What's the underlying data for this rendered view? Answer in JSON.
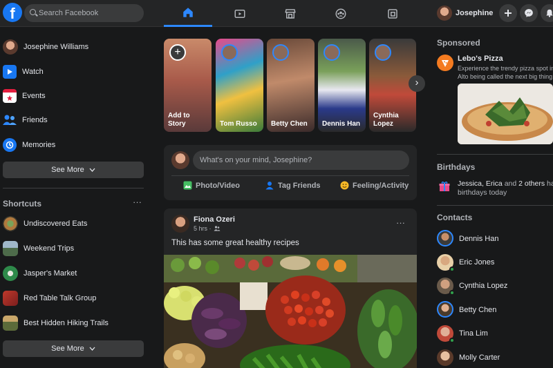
{
  "topbar": {
    "logo_letter": "f",
    "search_placeholder": "Search Facebook",
    "nav_icons": [
      "home-icon",
      "watch-icon",
      "marketplace-icon",
      "groups-icon",
      "gaming-icon"
    ],
    "profile_name": "Josephine",
    "action_icons": [
      "plus-icon",
      "messenger-icon",
      "notifications-icon"
    ],
    "accent_color": "#2d88ff"
  },
  "left_nav": {
    "items": [
      {
        "label": "Josephine Williams",
        "icon": "profile-avatar"
      },
      {
        "label": "Watch",
        "icon": "watch-icon"
      },
      {
        "label": "Events",
        "icon": "events-icon"
      },
      {
        "label": "Friends",
        "icon": "friends-icon"
      },
      {
        "label": "Memories",
        "icon": "memories-icon"
      }
    ],
    "see_more_label": "See More",
    "shortcuts_title": "Shortcuts",
    "shortcuts_menu": "···",
    "shortcuts": [
      {
        "label": "Undiscovered Eats"
      },
      {
        "label": "Weekend Trips"
      },
      {
        "label": "Jasper's Market"
      },
      {
        "label": "Red Table Talk Group"
      },
      {
        "label": "Best Hidden Hiking Trails"
      }
    ],
    "shortcuts_see_more_label": "See More"
  },
  "stories": {
    "items": [
      {
        "name_line1": "Add to",
        "name_line2": "Story"
      },
      {
        "name_line1": "Tom Russo",
        "name_line2": ""
      },
      {
        "name_line1": "Betty Chen",
        "name_line2": ""
      },
      {
        "name_line1": "Dennis Han",
        "name_line2": ""
      },
      {
        "name_line1": "Cynthia",
        "name_line2": "Lopez"
      }
    ],
    "add_glyph": "+",
    "next_glyph": "›"
  },
  "composer": {
    "placeholder": "What's on your mind, Josephine?",
    "actions": [
      {
        "label": "Photo/Video",
        "icon": "photo-video-icon",
        "color": "#45bd62"
      },
      {
        "label": "Tag Friends",
        "icon": "tag-friends-icon",
        "color": "#1877f2"
      },
      {
        "label": "Feeling/Activity",
        "icon": "feeling-activity-icon",
        "color": "#f7b928"
      }
    ]
  },
  "post": {
    "author": "Fiona Ozeri",
    "time": "5 hrs ·",
    "privacy_icon": "friends-privacy-icon",
    "menu": "···",
    "text": "This has some great healthy recipes"
  },
  "sponsored": {
    "title": "Sponsored",
    "advertiser": "Lebo's Pizza",
    "description_line1": "Experience the trendy pizza spot in Palo",
    "description_line2": "Alto being called the next big thing."
  },
  "birthdays": {
    "title": "Birthdays",
    "names": "Jessica, Erica",
    "connector": " and ",
    "others": "2 others",
    "suffix": " have",
    "line2": "birthdays today"
  },
  "contacts": {
    "title": "Contacts",
    "items": [
      {
        "name": "Dennis Han",
        "ring": true,
        "online": false
      },
      {
        "name": "Eric Jones",
        "ring": false,
        "online": true
      },
      {
        "name": "Cynthia Lopez",
        "ring": false,
        "online": true
      },
      {
        "name": "Betty Chen",
        "ring": true,
        "online": false
      },
      {
        "name": "Tina Lim",
        "ring": false,
        "online": true
      },
      {
        "name": "Molly Carter",
        "ring": false,
        "online": false
      }
    ]
  }
}
